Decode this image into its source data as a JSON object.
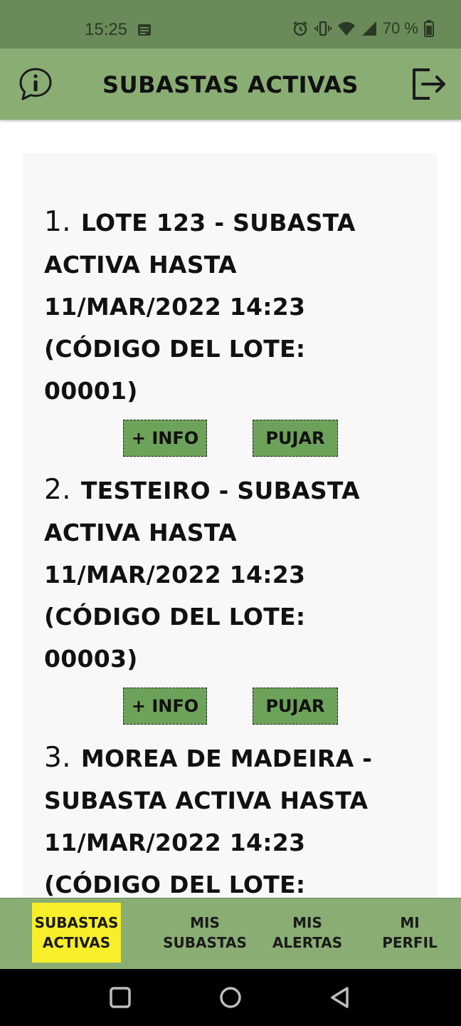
{
  "status_bar": {
    "time": "15:25",
    "battery": "70 %"
  },
  "header": {
    "title": "SUBASTAS ACTIVAS"
  },
  "lots": [
    {
      "number": "1.",
      "text": "LOTE 123 - SUBASTA ACTIVA HASTA 11/MAR/2022 14:23 (CÓDIGO DEL LOTE: 00001)",
      "info_label": "+ INFO",
      "bid_label": "PUJAR"
    },
    {
      "number": "2.",
      "text": "TESTEIRO - SUBASTA ACTIVA HASTA 11/MAR/2022 14:23 (CÓDIGO DEL LOTE: 00003)",
      "info_label": "+ INFO",
      "bid_label": "PUJAR"
    },
    {
      "number": "3.",
      "text": "MOREA DE MADEIRA - SUBASTA ACTIVA HASTA 11/MAR/2022 14:23 (CÓDIGO DEL LOTE:"
    }
  ],
  "bottom_nav": [
    {
      "line1": "SUBASTAS",
      "line2": "ACTIVAS",
      "active": true
    },
    {
      "line1": "MIS",
      "line2": "SUBASTAS",
      "active": false
    },
    {
      "line1": "MIS",
      "line2": "ALERTAS",
      "active": false
    },
    {
      "line1": "MI",
      "line2": "PERFIL",
      "active": false
    }
  ],
  "colors": {
    "status_bar": "#6b8a5a",
    "app_bar": "#8aad74",
    "button": "#6da25a",
    "active_tab": "#f8ee2a",
    "list_bg": "#f8f8f8"
  },
  "icons": {
    "header_left": "info-bubble-icon",
    "header_right": "logout-icon",
    "system_nav": [
      "square-icon",
      "circle-icon",
      "triangle-back-icon"
    ]
  }
}
